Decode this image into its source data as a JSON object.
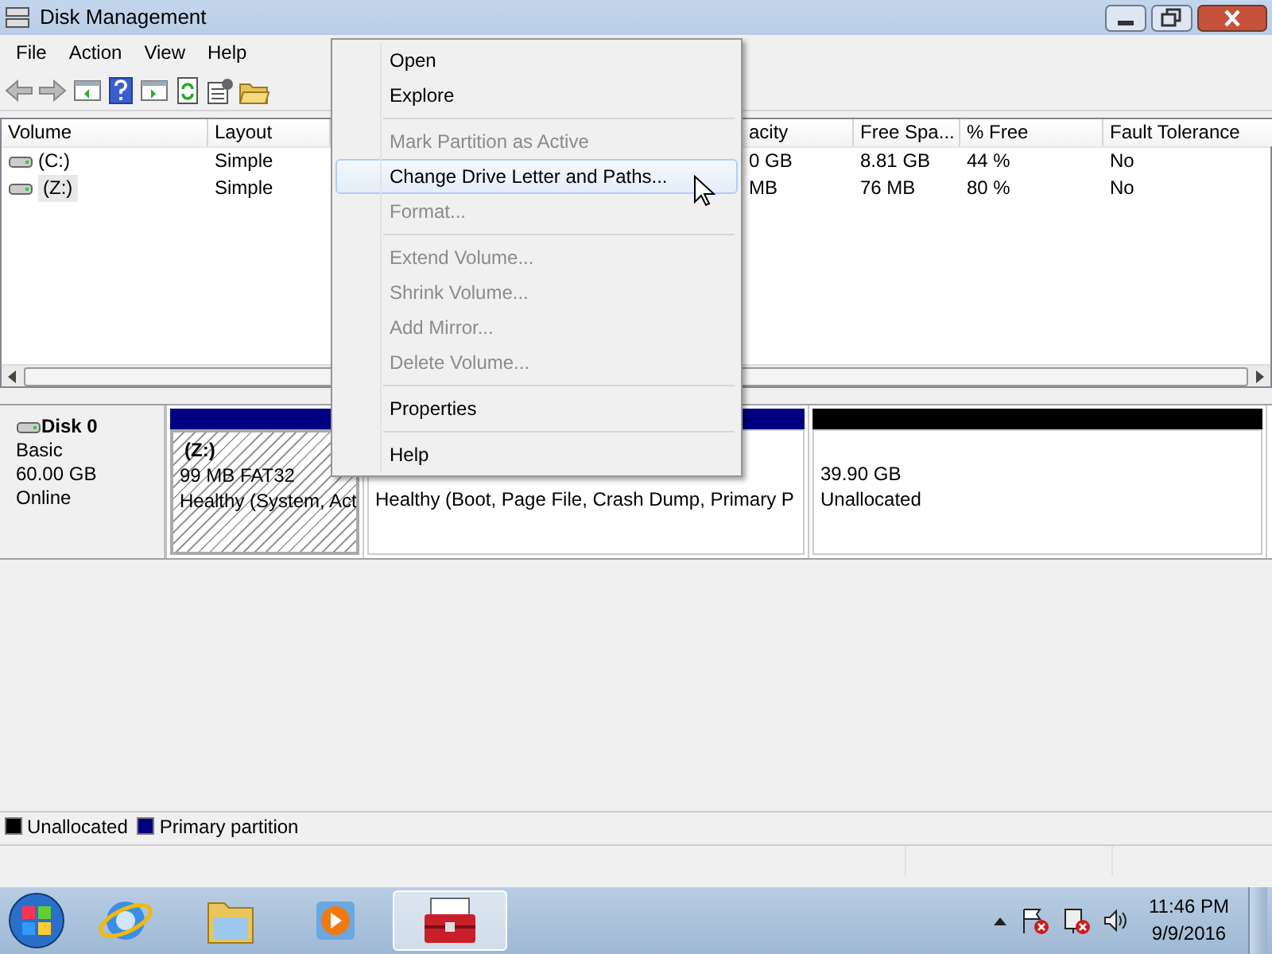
{
  "window": {
    "title": "Disk Management"
  },
  "menu_bar": [
    "File",
    "Action",
    "View",
    "Help"
  ],
  "volume_list": {
    "columns": [
      "Volume",
      "Layout",
      "acity",
      "Free Spa...",
      "% Free",
      "Fault Tolerance"
    ],
    "rows": [
      {
        "cells": [
          "(C:)",
          "Simple",
          "0 GB",
          "8.81 GB",
          "44 %",
          "No"
        ],
        "selected": false
      },
      {
        "cells": [
          "(Z:)",
          "Simple",
          "MB",
          "76 MB",
          "80 %",
          "No"
        ],
        "selected": true
      }
    ]
  },
  "disk": {
    "name": "Disk 0",
    "type": "Basic",
    "size": "60.00 GB",
    "status": "Online",
    "partitions": [
      {
        "kind": "primary",
        "label": "(Z:)",
        "size": "99 MB FAT32",
        "status": "Healthy (System, Act",
        "selected": true
      },
      {
        "kind": "primary",
        "status": "Healthy (Boot, Page File, Crash Dump, Primary P",
        "selected": false
      },
      {
        "kind": "unallocated",
        "size": "39.90 GB",
        "status": "Unallocated",
        "selected": false
      }
    ]
  },
  "legend": [
    {
      "label": "Unallocated",
      "color": "#000000"
    },
    {
      "label": "Primary partition",
      "color": "#000080"
    }
  ],
  "context_menu": [
    {
      "kind": "item",
      "label": "Open",
      "disabled": false,
      "selected": false
    },
    {
      "kind": "item",
      "label": "Explore",
      "disabled": false,
      "selected": false
    },
    {
      "kind": "separator"
    },
    {
      "kind": "item",
      "label": "Mark Partition as Active",
      "disabled": true,
      "selected": false
    },
    {
      "kind": "item",
      "label": "Change Drive Letter and Paths...",
      "disabled": false,
      "selected": true
    },
    {
      "kind": "item",
      "label": "Format...",
      "disabled": true,
      "selected": false
    },
    {
      "kind": "separator"
    },
    {
      "kind": "item",
      "label": "Extend Volume...",
      "disabled": true,
      "selected": false
    },
    {
      "kind": "item",
      "label": "Shrink Volume...",
      "disabled": true,
      "selected": false
    },
    {
      "kind": "item",
      "label": "Add Mirror...",
      "disabled": true,
      "selected": false
    },
    {
      "kind": "item",
      "label": "Delete Volume...",
      "disabled": true,
      "selected": false
    },
    {
      "kind": "separator"
    },
    {
      "kind": "item",
      "label": "Properties",
      "disabled": false,
      "selected": false
    },
    {
      "kind": "separator"
    },
    {
      "kind": "item",
      "label": "Help",
      "disabled": false,
      "selected": false
    }
  ],
  "taskbar": {
    "time": "11:46 PM",
    "date": "9/9/2016"
  }
}
